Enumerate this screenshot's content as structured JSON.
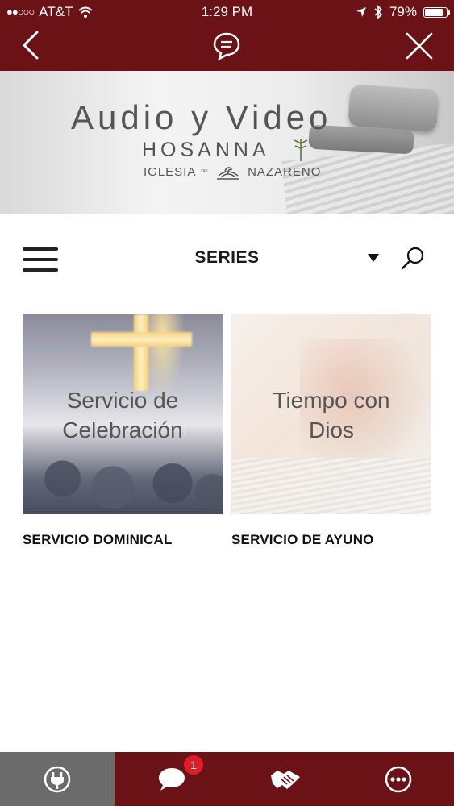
{
  "status_bar": {
    "carrier": "AT&T",
    "time": "1:29 PM",
    "battery": "79%",
    "battery_level": 0.79,
    "signal_icon": "signal-dots-icon",
    "wifi_icon": "wifi-icon",
    "location_icon": "location-arrow-icon",
    "bluetooth_icon": "bluetooth-icon"
  },
  "nav": {
    "back_icon": "chevron-left-icon",
    "chat_icon": "chat-bubble-icon",
    "close_icon": "close-icon",
    "color": "#6b1216"
  },
  "banner": {
    "title": "Audio y Video",
    "brand": "HOSANNA",
    "sub_left": "IGLESIA",
    "sub_small": "DEL",
    "sub_right": "NAZARENO"
  },
  "toolbar": {
    "menu_icon": "hamburger-menu-icon",
    "title": "SERIES",
    "dropdown_icon": "caret-down-icon",
    "search_icon": "search-icon"
  },
  "series": [
    {
      "thumb_line1": "Servicio de",
      "thumb_line2": "Celebración",
      "label": "SERVICIO DOMINICAL"
    },
    {
      "thumb_line1": "Tiempo con",
      "thumb_line2": "Dios",
      "label": "SERVICIO DE AYUNO"
    }
  ],
  "tabbar": {
    "tabs": [
      {
        "icon": "plug-icon",
        "active": true
      },
      {
        "icon": "chat-icon",
        "badge": "1"
      },
      {
        "icon": "handshake-icon"
      },
      {
        "icon": "more-icon"
      }
    ],
    "active_color": "#6b6b6b",
    "bar_color": "#6b1216",
    "badge_color": "#e11b2a"
  }
}
